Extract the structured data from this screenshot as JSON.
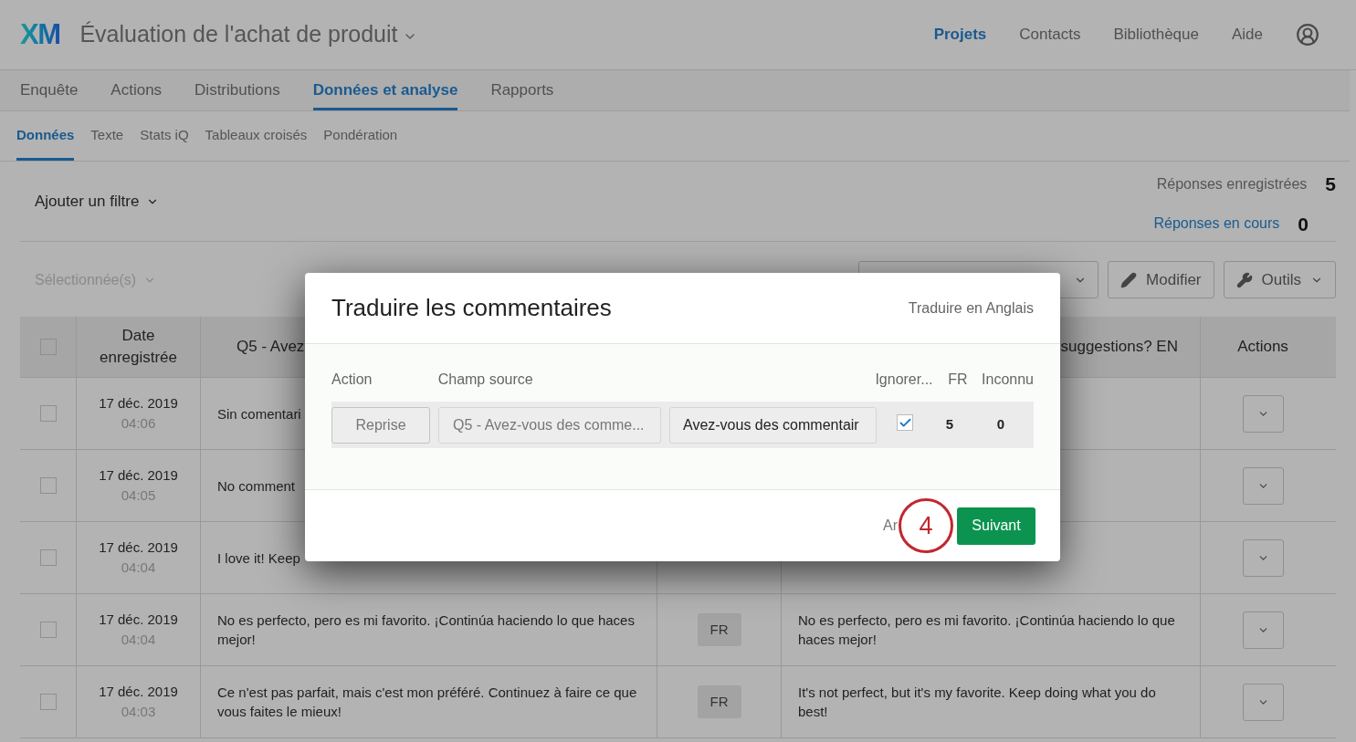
{
  "header": {
    "logo": "XM",
    "project_title": "Évaluation de l'achat de produit",
    "top_nav": [
      {
        "label": "Projets",
        "selected": true
      },
      {
        "label": "Contacts",
        "selected": false
      },
      {
        "label": "Bibliothèque",
        "selected": false
      },
      {
        "label": "Aide",
        "selected": false
      }
    ]
  },
  "main_tabs": [
    {
      "label": "Enquête",
      "selected": false
    },
    {
      "label": "Actions",
      "selected": false
    },
    {
      "label": "Distributions",
      "selected": false
    },
    {
      "label": "Données et analyse",
      "selected": true
    },
    {
      "label": "Rapports",
      "selected": false
    }
  ],
  "sub_tabs": [
    {
      "label": "Données",
      "selected": true
    },
    {
      "label": "Texte",
      "selected": false
    },
    {
      "label": "Stats iQ",
      "selected": false
    },
    {
      "label": "Tableaux croisés",
      "selected": false
    },
    {
      "label": "Pondération",
      "selected": false
    }
  ],
  "filter": {
    "label": "Ajouter un filtre"
  },
  "counts": [
    {
      "label": "Réponses enregistrées",
      "value": "5",
      "kind": "plain"
    },
    {
      "label": "Réponses en cours",
      "value": "0",
      "kind": "link"
    }
  ],
  "toolbar": {
    "selection": "Sélectionnée(s)",
    "buttons": [
      {
        "label": "Modifier",
        "kind": "pencil"
      },
      {
        "label": "Outils",
        "kind": "wrench"
      }
    ]
  },
  "table": {
    "header_checked": false,
    "columns": {
      "date": "Date enregistrée",
      "question": "Q5 - Avez",
      "translation": "suggestions? EN",
      "actions": "Actions"
    },
    "rows": [
      {
        "checked": false,
        "date": "17 déc. 2019",
        "time": "04:06",
        "response": "Sin comentari"
      },
      {
        "checked": false,
        "date": "17 déc. 2019",
        "time": "04:05",
        "response": "No comment"
      },
      {
        "checked": false,
        "date": "17 déc. 2019",
        "time": "04:04",
        "response": "I love it! Keep"
      },
      {
        "checked": false,
        "date": "17 déc. 2019",
        "time": "04:04",
        "response": "No es perfecto, pero es mi favorito. ¡Continúa haciendo lo que haces mejor!",
        "language": "FR",
        "translation": "No es perfecto, pero es mi favorito. ¡Continúa haciendo lo que haces mejor!"
      },
      {
        "checked": false,
        "date": "17 déc. 2019",
        "time": "04:03",
        "response": "Ce n'est pas parfait, mais c'est mon préféré. Continuez à faire ce que vous faites le mieux!",
        "language": "FR",
        "translation": "It's not perfect, but it's my favorite. Keep doing what you do best!"
      }
    ]
  },
  "dialog": {
    "title": "Traduire les commentaires",
    "target": "Traduire en Anglais",
    "columns": [
      "Action",
      "Champ source",
      "Ignorer...",
      "FR",
      "Inconnu"
    ],
    "row": {
      "action": "Reprise",
      "source": "Q5 - Avez-vous des comme...",
      "field": "Avez-vous des commentair",
      "ignore": true,
      "fr_count": "5",
      "unknown_count": "0"
    },
    "cancel": "Ar",
    "next": "Suivant"
  },
  "callout": {
    "number": "4"
  }
}
